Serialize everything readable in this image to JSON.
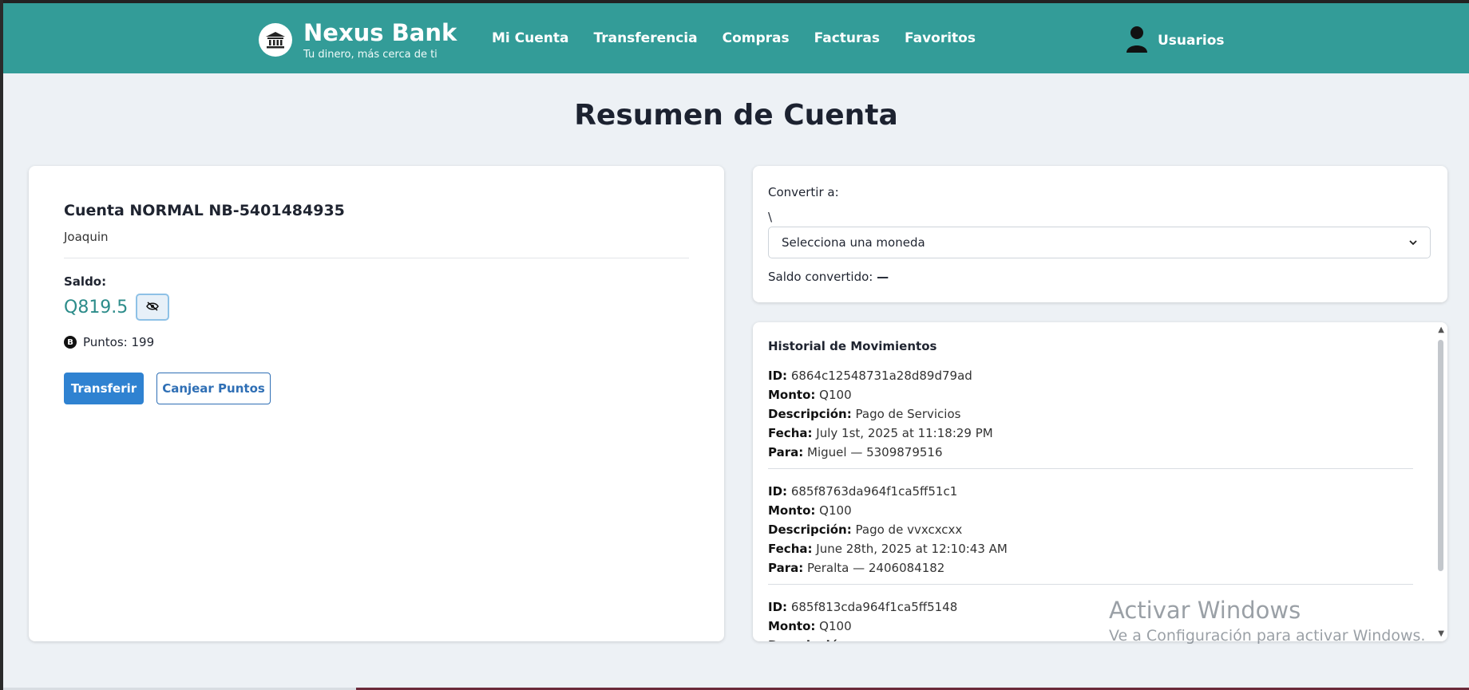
{
  "navbar": {
    "brand_name": "Nexus Bank",
    "brand_tagline": "Tu dinero, más cerca de ti",
    "links": [
      "Mi Cuenta",
      "Transferencia",
      "Compras",
      "Facturas",
      "Favoritos"
    ],
    "user_label": "Usuarios",
    "color": "#339c98"
  },
  "page_title": "Resumen de Cuenta",
  "account": {
    "title": "Cuenta NORMAL NB-5401484935",
    "owner": "Joaquin",
    "saldo_label": "Saldo:",
    "saldo_value": "Q819.5",
    "points_label": "Puntos: 199",
    "transfer_button": "Transferir",
    "redeem_button": "Canjear Puntos"
  },
  "convert": {
    "label": "Convertir a:",
    "stray_text": "\\",
    "select_value": "Selecciona una moneda",
    "result_label": "Saldo convertido:",
    "result_value": "—"
  },
  "history": {
    "title": "Historial de Movimientos",
    "field_labels": {
      "id": "ID:",
      "monto": "Monto:",
      "descripcion": "Descripción:",
      "fecha": "Fecha:",
      "para": "Para:"
    },
    "movements": [
      {
        "id": "6864c12548731a28d89d79ad",
        "monto": "Q100",
        "descripcion": "Pago de Servicios",
        "fecha": "July 1st, 2025 at 11:18:29 PM",
        "para": "Miguel — 5309879516"
      },
      {
        "id": "685f8763da964f1ca5ff51c1",
        "monto": "Q100",
        "descripcion": "Pago de vvxcxcxx",
        "fecha": "June 28th, 2025 at 12:10:43 AM",
        "para": "Peralta — 2406084182"
      },
      {
        "id": "685f813cda964f1ca5ff5148",
        "monto": "Q100",
        "descripcion": "",
        "fecha": "",
        "para": ""
      }
    ]
  },
  "watermark": {
    "title": "Activar Windows",
    "subtitle": "Ve a Configuración para activar Windows."
  }
}
